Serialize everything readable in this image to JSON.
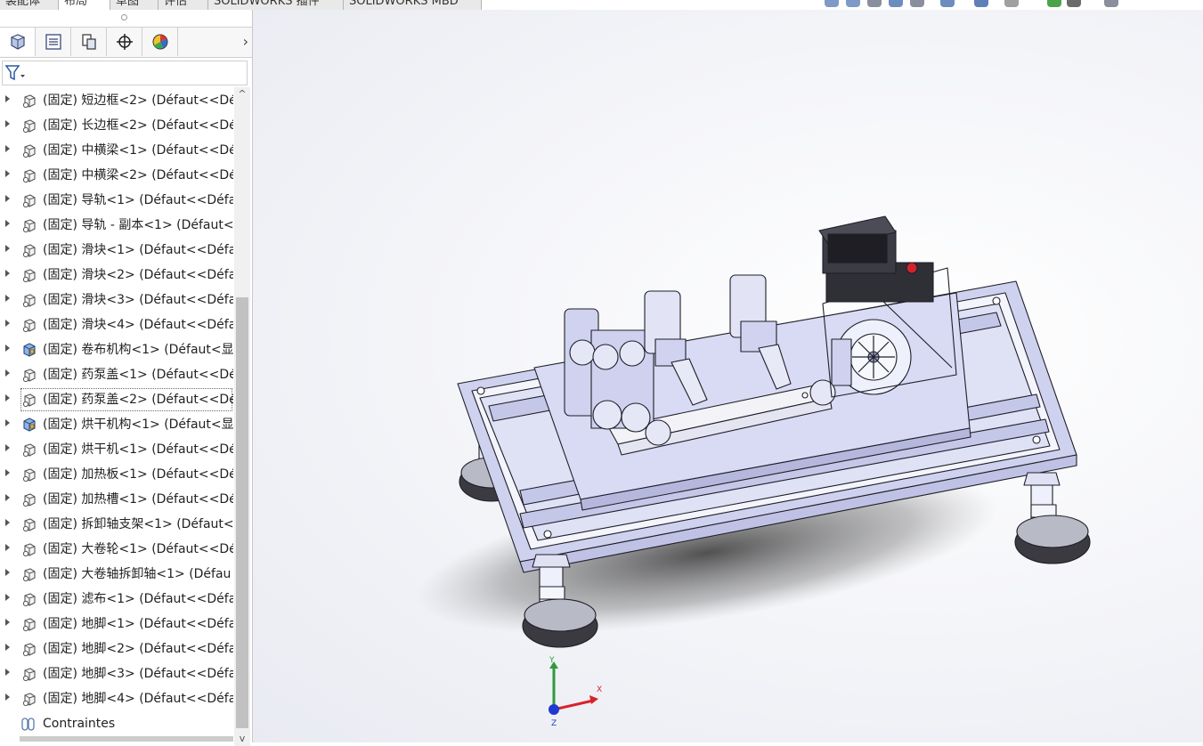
{
  "top_tabs": [
    "装配体",
    "布局",
    "草图",
    "评估",
    "SOLIDWORKS 插件",
    "SOLIDWORKS MBD"
  ],
  "active_tab_index": 1,
  "manager_tabs": [
    {
      "icon": "featuremanager-tree-icon"
    },
    {
      "icon": "propertymanager-icon"
    },
    {
      "icon": "configurationmanager-icon"
    },
    {
      "icon": "dimxpertmanager-icon"
    },
    {
      "icon": "display-manager-icon"
    }
  ],
  "feature_tree": {
    "items": [
      {
        "label": "(固定) 短边框<2> (Défaut<<Dé",
        "type": "part"
      },
      {
        "label": "(固定) 长边框<2> (Défaut<<Dé",
        "type": "part"
      },
      {
        "label": "(固定) 中横梁<1> (Défaut<<Dé",
        "type": "part"
      },
      {
        "label": "(固定) 中横梁<2> (Défaut<<Dé",
        "type": "part"
      },
      {
        "label": "(固定) 导轨<1> (Défaut<<Défa",
        "type": "part"
      },
      {
        "label": "(固定) 导轨 - 副本<1> (Défaut<",
        "type": "part"
      },
      {
        "label": "(固定) 滑块<1> (Défaut<<Défa",
        "type": "part"
      },
      {
        "label": "(固定) 滑块<2> (Défaut<<Défa",
        "type": "part"
      },
      {
        "label": "(固定) 滑块<3> (Défaut<<Défa",
        "type": "part"
      },
      {
        "label": "(固定) 滑块<4> (Défaut<<Défa",
        "type": "part"
      },
      {
        "label": "(固定) 卷布机构<1> (Défaut<显",
        "type": "assembly"
      },
      {
        "label": "(固定) 药泵盖<1> (Défaut<<Dé",
        "type": "part"
      },
      {
        "label": "(固定) 药泵盖<2> (Défaut<<Dé",
        "type": "part",
        "selected": true
      },
      {
        "label": "(固定) 烘干机构<1> (Défaut<显",
        "type": "assembly"
      },
      {
        "label": "(固定) 烘干机<1> (Défaut<<Dé",
        "type": "part"
      },
      {
        "label": "(固定) 加热板<1> (Défaut<<Dé",
        "type": "part"
      },
      {
        "label": "(固定) 加热槽<1> (Défaut<<Dé",
        "type": "part"
      },
      {
        "label": "(固定) 拆卸轴支架<1> (Défaut<",
        "type": "part"
      },
      {
        "label": "(固定) 大卷轮<1> (Défaut<<Dé",
        "type": "part"
      },
      {
        "label": "(固定) 大卷轴拆卸轴<1> (Défau",
        "type": "part"
      },
      {
        "label": "(固定) 滤布<1> (Défaut<<Défa",
        "type": "part"
      },
      {
        "label": "(固定) 地脚<1> (Défaut<<Défa",
        "type": "part"
      },
      {
        "label": "(固定) 地脚<2> (Défaut<<Défa",
        "type": "part"
      },
      {
        "label": "(固定) 地脚<3> (Défaut<<Défa",
        "type": "part"
      },
      {
        "label": "(固定) 地脚<4> (Défaut<<Défa",
        "type": "part"
      },
      {
        "label": "Contraintes",
        "type": "mates"
      }
    ]
  },
  "triad": {
    "x": "X",
    "y": "Y",
    "z": "Z"
  },
  "colors": {
    "model_fill": "#d6d8f2",
    "model_edge": "#1e1e28",
    "triad_x": "#d8232a",
    "triad_y": "#2e9a3c",
    "triad_z": "#1e3ad0",
    "selection": "#6a6a6a"
  }
}
